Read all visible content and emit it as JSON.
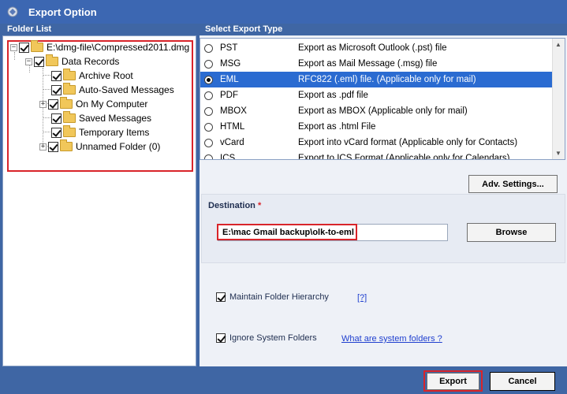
{
  "window": {
    "title": "Export Option"
  },
  "folder_list": {
    "label": "Folder List",
    "items": [
      {
        "label": "E:\\dmg-file\\Compressed2011.dmg"
      },
      {
        "label": "Data Records"
      },
      {
        "label": "Archive Root"
      },
      {
        "label": "Auto-Saved Messages"
      },
      {
        "label": "On My Computer"
      },
      {
        "label": "Saved Messages"
      },
      {
        "label": "Temporary Items"
      },
      {
        "label": "Unnamed Folder (0)"
      }
    ]
  },
  "export_types": {
    "label": "Select Export Type",
    "selected": "EML",
    "items": [
      {
        "name": "PST",
        "desc": "Export as Microsoft Outlook (.pst) file"
      },
      {
        "name": "MSG",
        "desc": "Export as Mail Message (.msg) file"
      },
      {
        "name": "EML",
        "desc": "RFC822 (.eml) file. (Applicable only for mail)"
      },
      {
        "name": "PDF",
        "desc": "Export as .pdf file"
      },
      {
        "name": "MBOX",
        "desc": "Export as MBOX (Applicable only for mail)"
      },
      {
        "name": "HTML",
        "desc": "Export as .html File"
      },
      {
        "name": "vCard",
        "desc": "Export into vCard format (Applicable only for Contacts)"
      },
      {
        "name": "ICS",
        "desc": "Export to ICS Format (Applicable only for Calendars)"
      }
    ]
  },
  "adv_settings_label": "Adv. Settings...",
  "destination": {
    "label": "Destination",
    "required_mark": "*",
    "value": "E:\\mac Gmail backup\\olk-to-eml",
    "browse_label": "Browse"
  },
  "options": {
    "maintain_hierarchy": {
      "label": "Maintain Folder Hierarchy",
      "link": "[?]",
      "checked": true
    },
    "ignore_system": {
      "label": "Ignore System Folders",
      "link": "What are system folders ?",
      "checked": true
    }
  },
  "footer": {
    "export_label": "Export",
    "cancel_label": "Cancel"
  }
}
